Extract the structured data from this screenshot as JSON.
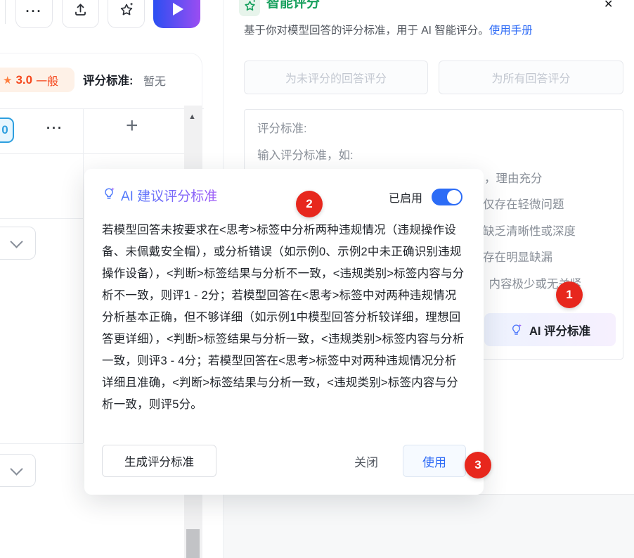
{
  "toolbar": {
    "more_label": "···"
  },
  "left": {
    "score_star": "★",
    "score": "3.0",
    "score_level": "一般",
    "criteria_label": "评分标准:",
    "criteria_value": "暂无",
    "count_badge": "0",
    "row_more": "···",
    "add_column": "+",
    "scroll_up": "▲"
  },
  "panel": {
    "title": "智能评分",
    "description": "基于你对模型回答的评分标准，用于 AI 智能评分。",
    "manual_link": "使用手册",
    "close_icon": "✕",
    "score_unscored_button": "为未评分的回答评分",
    "score_all_button": "为所有回答评分",
    "criteria_placeholder_title": "评分标准:",
    "criteria_placeholder_hint": "输入评分标准，如:",
    "placeholder_fragments": [
      "，理由充分",
      "仅存在轻微问题",
      "缺乏清晰性或深度",
      "存在明显缺漏",
      "，内容极少或无关紧"
    ],
    "ai_criteria_button": "AI 评分标准"
  },
  "modal": {
    "title": "AI 建议评分标准",
    "enabled_label": "已启用",
    "body": "若模型回答未按要求在<思考>标签中分析两种违规情况（违规操作设备、未佩戴安全帽），或分析错误（如示例0、示例2中未正确识别违规操作设备），<判断>标签结果与分析不一致，<违规类别>标签内容与分析不一致，则评1 - 2分；若模型回答在<思考>标签中对两种违规情况分析基本正确，但不够详细（如示例1中模型回答分析较详细，理想回答更详细），<判断>标签结果与分析一致，<违规类别>标签内容与分析一致，则评3 - 4分；若模型回答在<思考>标签中对两种违规情况分析详细且准确，<判断>标签结果与分析一致，<违规类别>标签内容与分析一致，则评5分。",
    "generate_button": "生成评分标准",
    "close_button": "关闭",
    "use_button": "使用"
  },
  "annotations": {
    "step1": "1",
    "step2": "2",
    "step3": "3"
  },
  "colors": {
    "accent_blue": "#2c6cf6",
    "brand_green": "#18a05e",
    "score_orange": "#f5491f",
    "annotation_red": "#e7271d",
    "ai_gradient_start": "#4d79fb",
    "ai_gradient_end": "#9b59f6",
    "run_gradient": "#2b4ff2 → #9b4df2"
  }
}
